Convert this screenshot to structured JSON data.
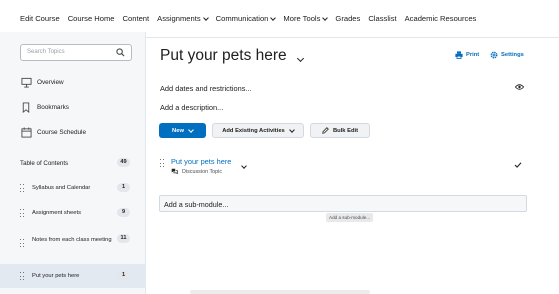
{
  "nav": {
    "items": [
      {
        "label": "Edit Course",
        "dropdown": false
      },
      {
        "label": "Course Home",
        "dropdown": false
      },
      {
        "label": "Content",
        "dropdown": false
      },
      {
        "label": "Assignments",
        "dropdown": true
      },
      {
        "label": "Communication",
        "dropdown": true
      },
      {
        "label": "More Tools",
        "dropdown": true
      },
      {
        "label": "Grades",
        "dropdown": false
      },
      {
        "label": "Classlist",
        "dropdown": false
      },
      {
        "label": "Academic Resources",
        "dropdown": false
      }
    ]
  },
  "sidebar": {
    "search_placeholder": "Search Topics",
    "links": [
      {
        "label": "Overview",
        "icon": "overview-icon"
      },
      {
        "label": "Bookmarks",
        "icon": "bookmark-icon"
      },
      {
        "label": "Course Schedule",
        "icon": "calendar-icon"
      }
    ],
    "toc": {
      "label": "Table of Contents",
      "count": "49"
    },
    "modules": [
      {
        "label": "Syllabus and Calendar",
        "count": "1"
      },
      {
        "label": "Assignment sheets",
        "count": "9"
      },
      {
        "label": "Notes from each class meeting",
        "count": "11"
      },
      {
        "label": "Put your pets here",
        "count": "1"
      }
    ]
  },
  "main": {
    "title": "Put your pets here",
    "print_label": "Print",
    "settings_label": "Settings",
    "add_dates": "Add dates and restrictions...",
    "add_description": "Add a description...",
    "buttons": {
      "new": "New",
      "add_existing": "Add Existing Activities",
      "bulk_edit": "Bulk Edit"
    },
    "topic": {
      "title": "Put your pets here",
      "type": "Discussion Topic"
    },
    "submodule_placeholder": "Add a sub-module...",
    "tooltip": "Add a sub-module..."
  },
  "colors": {
    "accent": "#006fbf",
    "sidebar_bg": "#f6f7f8",
    "selected_bg": "#e3e9f1"
  }
}
